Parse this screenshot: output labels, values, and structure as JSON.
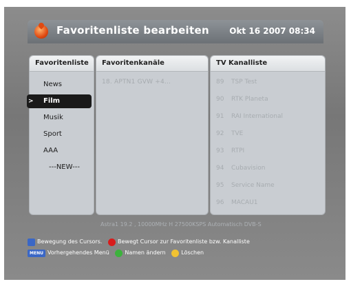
{
  "header": {
    "title": "Favoritenliste bearbeiten",
    "datetime": "Okt 16 2007 08:34"
  },
  "favorites": {
    "title": "Favoritenliste",
    "items": [
      "News",
      "Film",
      "Musik",
      "Sport",
      "AAA",
      "---NEW---"
    ],
    "selected": "Film"
  },
  "favorite_channels": {
    "title": "Favoritenkanäle",
    "items": [
      "18. APTN1 GVW +4..."
    ]
  },
  "tv_list": {
    "title": "TV Kanalliste",
    "items": [
      {
        "num": "89",
        "name": "TSP Test"
      },
      {
        "num": "90",
        "name": "RTK Planeta"
      },
      {
        "num": "91",
        "name": "RAI International"
      },
      {
        "num": "92",
        "name": "TVE"
      },
      {
        "num": "93",
        "name": "RTPI"
      },
      {
        "num": "94",
        "name": "Cubavision"
      },
      {
        "num": "95",
        "name": "Service Name"
      },
      {
        "num": "96",
        "name": "MACAU1"
      }
    ]
  },
  "status": "Astra1 19.2 , 10000MHz H 27500KSPS Automatisch DVB-S",
  "help": {
    "arrows_text": "Bewegung des Cursors.",
    "red_text": "Bewegt Cursor zur Favoritenliste bzw. Kanalliste",
    "menu_key": "MENU",
    "menu_text": "Vorhergehendes Menü",
    "green_text": "Namen ändern",
    "yellow_text": "Löschen"
  }
}
